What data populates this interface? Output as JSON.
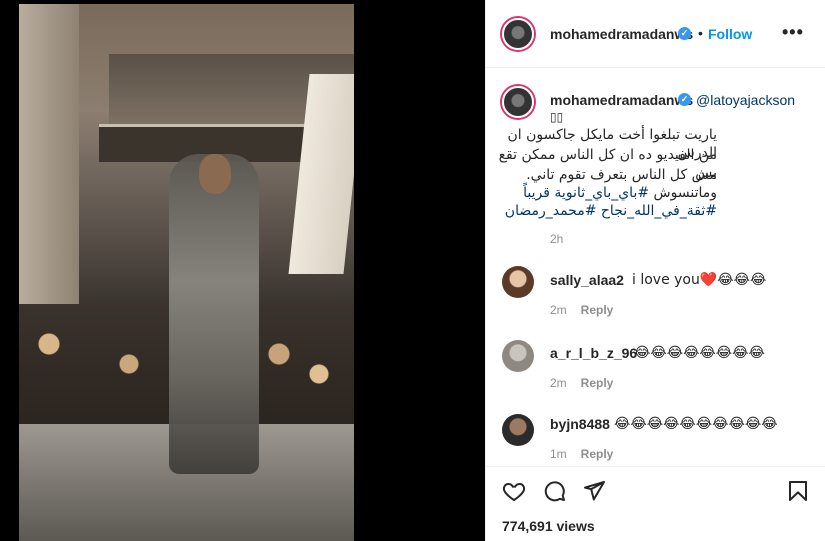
{
  "post": {
    "username": "mohamedramadanws",
    "dot": "•",
    "follow_label": "Follow",
    "more_label": "•••"
  },
  "caption": {
    "username": "mohamedramadanws",
    "mention": "@latoyajackson",
    "boxes": "▯▯",
    "line1": "ياريت تبلغوا أخت مايكل جاكسون ان الدرس",
    "line2": "من الفيديو ده ان كل الناس ممكن تقع بس",
    "line3": "مش كل الناس بتعرف تقوم تاني.",
    "line4_prefix": "وماتنسوش ",
    "line4_tag": "#باي_باي_ثانوية قريباً",
    "line5": "#ثقة_في_الله_نجاح #محمد_رمضان",
    "time": "2h"
  },
  "comments": [
    {
      "user": "sally_alaa2",
      "text": "i love you❤️😂😂😂",
      "time": "2m",
      "reply": "Reply"
    },
    {
      "user": "a_r_l_b_z_96",
      "text": "😂😂😂😂😂😂😂😂",
      "time": "2m",
      "reply": "Reply"
    },
    {
      "user": "byjn8488",
      "text": "😂😂😂😂😂😂😂😂😂😂",
      "time": "1m",
      "reply": "Reply"
    }
  ],
  "actions": {
    "views": "774,691 views",
    "icons": [
      "heart-icon",
      "comment-icon",
      "share-icon",
      "bookmark-icon"
    ]
  },
  "colors": {
    "accent": "#0095f6",
    "verified": "#3897f0",
    "link": "#00376b",
    "muted": "#8e8e8e",
    "heart": "#ed4956"
  }
}
